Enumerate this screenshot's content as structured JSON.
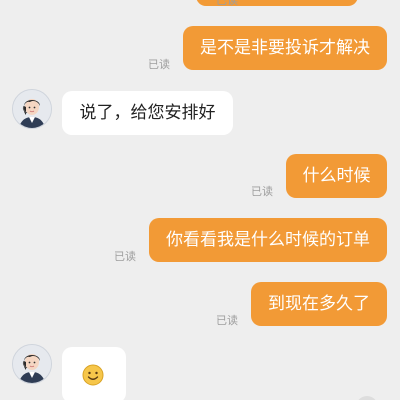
{
  "colors": {
    "background": "#eeeeee",
    "outgoing_bubble": "#f29a36",
    "incoming_bubble": "#ffffff",
    "read_label": "#9e9e9e"
  },
  "messages": [
    {
      "direction": "out",
      "text": "",
      "status": "已读"
    },
    {
      "direction": "out",
      "text": "是不是非要投诉才解决",
      "status": "已读"
    },
    {
      "direction": "in",
      "text": "说了，给您安排好",
      "avatar": "agent-avatar"
    },
    {
      "direction": "out",
      "text": "什么时候",
      "status": "已读"
    },
    {
      "direction": "out",
      "text": "你看看我是什么时候的订单",
      "status": "已读"
    },
    {
      "direction": "out",
      "text": "到现在多久了",
      "status": "已读"
    },
    {
      "direction": "in",
      "text": "",
      "emoji": "smiley-emoji",
      "avatar": "agent-avatar"
    }
  ]
}
